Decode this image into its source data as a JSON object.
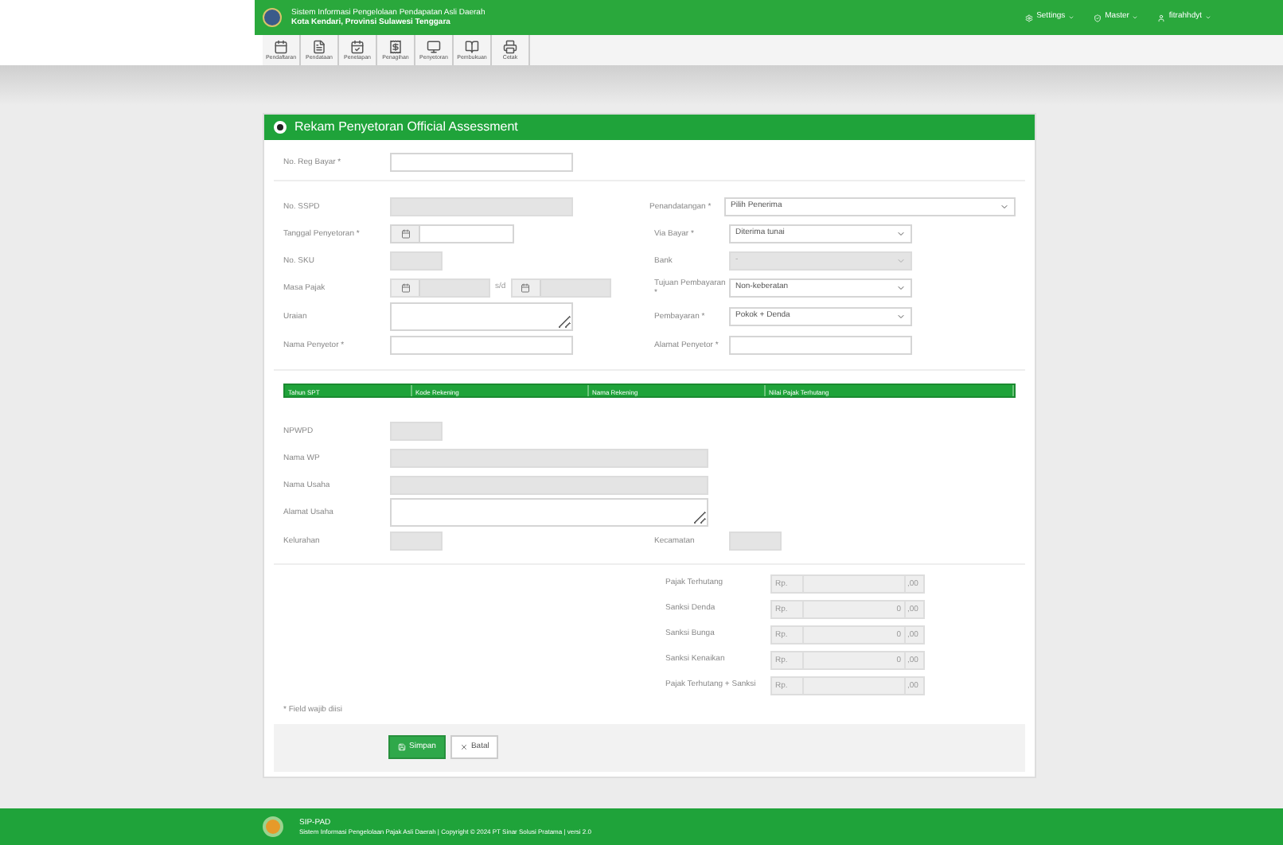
{
  "header": {
    "title": "Sistem Informasi Pengelolaan Pendapatan Asli Daerah",
    "subtitle": "Kota Kendari, Provinsi Sulawesi Tenggara",
    "menus": [
      {
        "label": "Settings",
        "kind": "settings"
      },
      {
        "label": "Master",
        "kind": "master"
      },
      {
        "label": "fitrahhdyt",
        "kind": "user"
      }
    ]
  },
  "toolbar": [
    {
      "label": "Pendaftaran",
      "kind": "calendar"
    },
    {
      "label": "Pendataan",
      "kind": "list"
    },
    {
      "label": "Penetapan",
      "kind": "check"
    },
    {
      "label": "Penagihan",
      "kind": "bill"
    },
    {
      "label": "Penyetoran",
      "kind": "monitor"
    },
    {
      "label": "Pembukuan",
      "kind": "book"
    },
    {
      "label": "Cetak",
      "kind": "print"
    }
  ],
  "form": {
    "title": "Rekam Penyetoran Official Assessment",
    "reg": {
      "label": "No. Reg Bayar *",
      "kind": "text",
      "disabled": false
    },
    "rows": [
      {
        "left": {
          "label": "No. SSPD",
          "kind": "text",
          "disabled": true
        },
        "right": {
          "label": "Penandatangan *",
          "kind": "select",
          "value": "Pilih Penerima",
          "wide": true,
          "disabled": false
        }
      },
      {
        "left": {
          "label": "Tanggal Penyetoran *",
          "kind": "date",
          "disabled": false
        },
        "right": {
          "label": "Via Bayar *",
          "kind": "select",
          "value": "Diterima tunai",
          "disabled": false
        }
      },
      {
        "left": {
          "label": "No. SKU",
          "kind": "short",
          "disabled": true
        },
        "right": {
          "label": "Bank",
          "kind": "select",
          "value": "-",
          "disabled": true
        }
      },
      {
        "left": {
          "label": "Masa Pajak",
          "kind": "range",
          "between": "s/d",
          "disabled": true
        },
        "right": {
          "label": "Tujuan Pembayaran *",
          "kind": "select",
          "value": "Non-keberatan",
          "disabled": false
        }
      },
      {
        "left": {
          "label": "Uraian",
          "kind": "textarea",
          "disabled": false
        },
        "right": {
          "label": "Pembayaran *",
          "kind": "select",
          "value": "Pokok + Denda",
          "disabled": false
        }
      },
      {
        "left": {
          "label": "Nama Penyetor *",
          "kind": "text",
          "disabled": false
        },
        "right": {
          "label": "Alamat Penyetor *",
          "kind": "text",
          "disabled": false
        }
      }
    ],
    "table": {
      "columns": [
        "Tahun SPT",
        "Kode Rekening",
        "Nama Rekening",
        "Nilai Pajak Terhutang"
      ]
    },
    "wp": [
      {
        "label": "NPWPD",
        "kind": "short",
        "disabled": true
      },
      {
        "label": "Nama WP",
        "kind": "long",
        "disabled": true
      },
      {
        "label": "Nama Usaha",
        "kind": "long",
        "disabled": true
      },
      {
        "label": "Alamat Usaha",
        "kind": "textarea",
        "disabled": false
      }
    ],
    "kel": {
      "label": "Kelurahan",
      "kind": "short",
      "disabled": true
    },
    "kec": {
      "label": "Kecamatan",
      "kind": "short",
      "disabled": true
    },
    "money": [
      {
        "label": "Pajak Terhutang",
        "prefix": "Rp.",
        "suffix": ",00"
      },
      {
        "label": "Sanksi Denda",
        "prefix": "Rp.",
        "value": "0",
        "suffix": ",00"
      },
      {
        "label": "Sanksi Bunga",
        "prefix": "Rp.",
        "value": "0",
        "suffix": ",00"
      },
      {
        "label": "Sanksi Kenaikan",
        "prefix": "Rp.",
        "value": "0",
        "suffix": ",00"
      },
      {
        "label": "Pajak Terhutang + Sanksi",
        "prefix": "Rp.",
        "suffix": ",00"
      }
    ],
    "note": "* Field wajib diisi",
    "buttons": [
      {
        "label": "Simpan",
        "kind": "primary"
      },
      {
        "label": "Batal",
        "kind": "secondary"
      }
    ]
  },
  "footer": {
    "title": "SIP-PAD",
    "text": "Sistem Informasi Pengelolaan Pajak Asli Daerah | Copyright © 2024 PT Sinar Solusi Pratama | versi 2.0"
  }
}
